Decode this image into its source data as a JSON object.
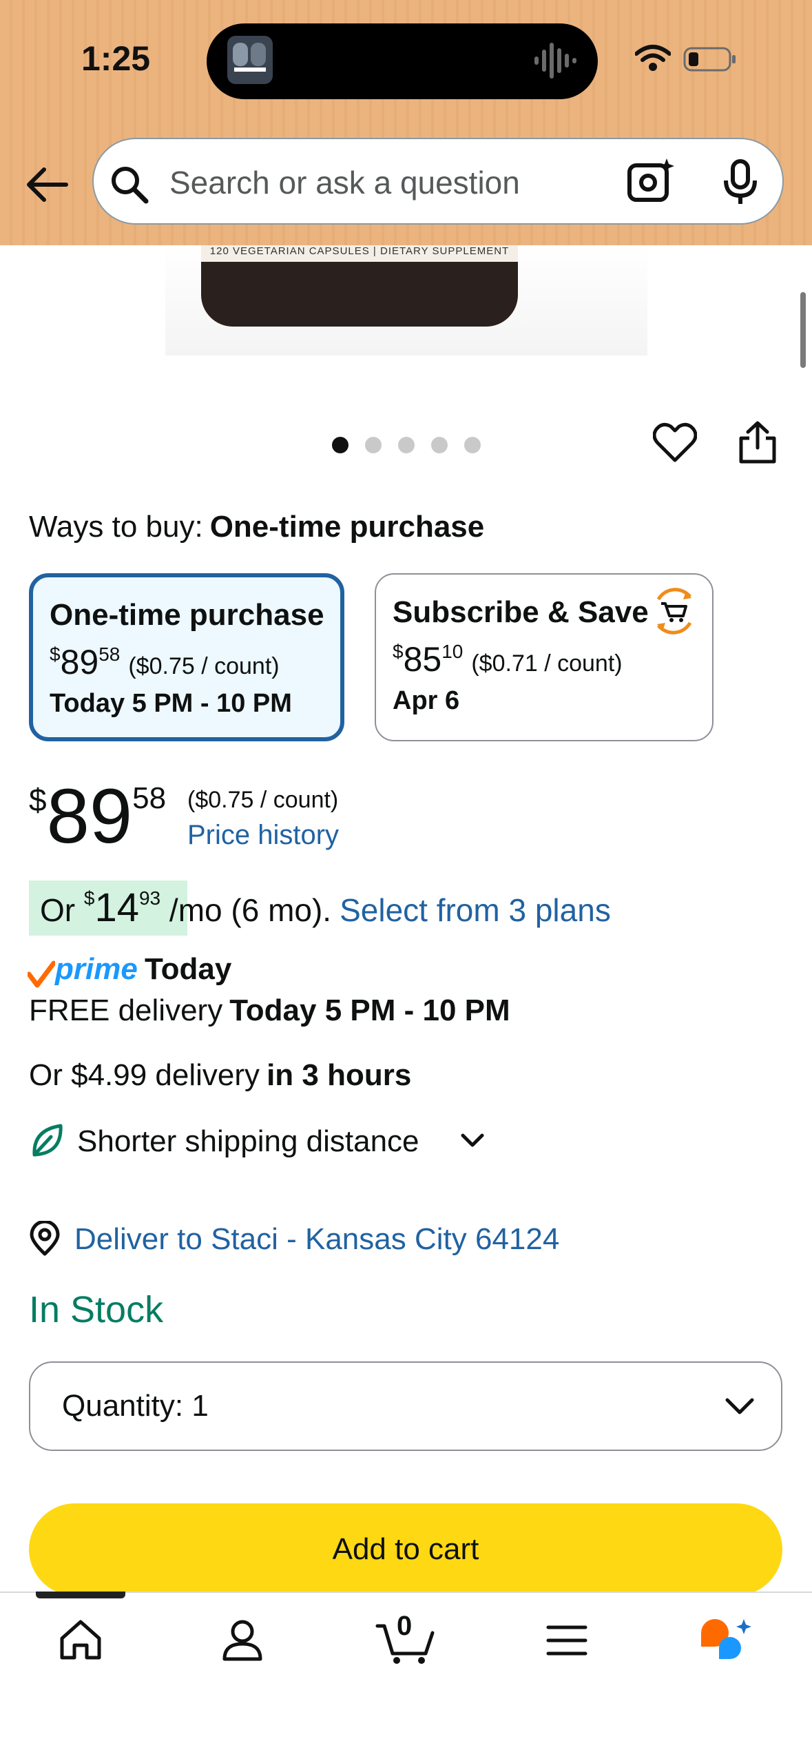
{
  "status_bar": {
    "time": "1:25"
  },
  "search": {
    "placeholder": "Search or ask a question"
  },
  "product_image": {
    "bottle_text": "120 VEGETARIAN CAPSULES | DIETARY SUPPLEMENT",
    "carousel_dots": 5,
    "active_dot": 0
  },
  "ways_to_buy": {
    "label": "Ways to buy:",
    "selected": "One-time purchase",
    "options": [
      {
        "title": "One-time purchase",
        "currency": "$",
        "price_whole": "89",
        "price_cents": "58",
        "unit_price": "($0.75 / count)",
        "delivery": "Today 5 PM - 10 PM",
        "selected": true
      },
      {
        "title": "Subscribe & Save",
        "currency": "$",
        "price_whole": "85",
        "price_cents": "10",
        "unit_price": "($0.71 / count)",
        "delivery": "Apr 6",
        "selected": false
      }
    ]
  },
  "price": {
    "currency": "$",
    "whole": "89",
    "cents": "58",
    "unit_price": "($0.75 / count)",
    "history_link": "Price history"
  },
  "installment": {
    "prefix": "Or",
    "currency": "$",
    "whole": "14",
    "cents": "93",
    "suffix": "/mo (6 mo).",
    "link": "Select from 3 plans"
  },
  "prime": {
    "brand": "prime",
    "label": "Today"
  },
  "delivery": {
    "free_label": "FREE delivery",
    "free_window": "Today 5 PM - 10 PM",
    "alt_label": "Or $4.99 delivery",
    "alt_window": "in 3 hours",
    "shipping_note": "Shorter shipping distance",
    "deliver_to": "Deliver to Staci - Kansas City 64124"
  },
  "stock": {
    "status": "In Stock"
  },
  "quantity": {
    "label": "Quantity:",
    "value": "1"
  },
  "add_to_cart": {
    "label": "Add to cart"
  },
  "nav": {
    "cart_count": "0"
  },
  "colors": {
    "link": "#2162a1",
    "stock": "#067d62",
    "cart_button": "#ffd814",
    "header": "#ebb47f"
  }
}
